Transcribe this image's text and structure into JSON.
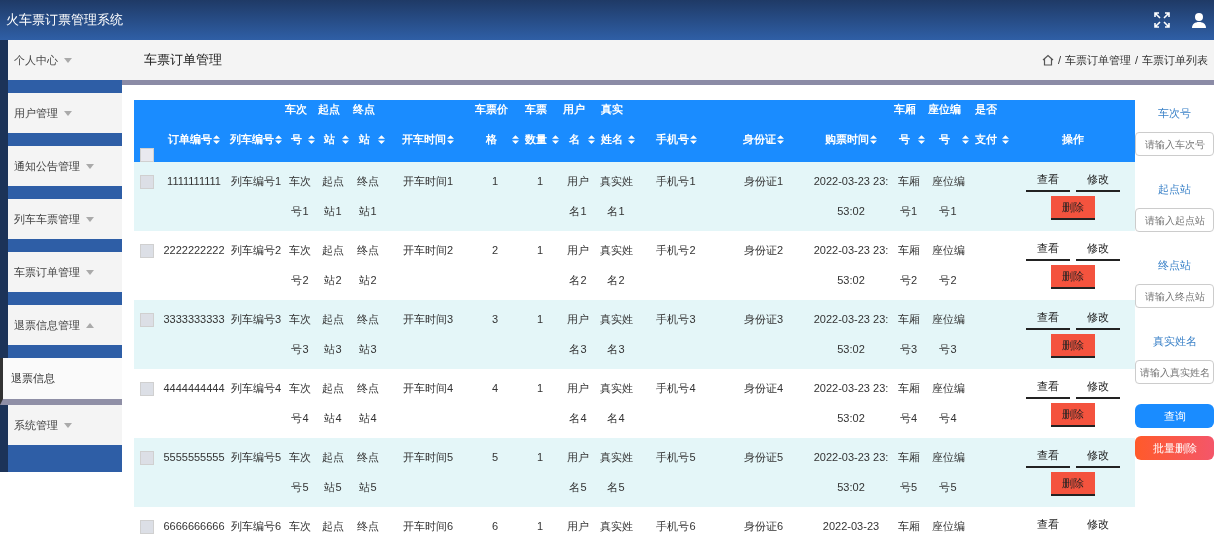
{
  "app_title": "火车票订票管理系统",
  "sidebar": {
    "items": [
      {
        "label": "个人中心",
        "expanded": false
      },
      {
        "label": "用户管理",
        "expanded": false
      },
      {
        "label": "通知公告管理",
        "expanded": false
      },
      {
        "label": "列车车票管理",
        "expanded": false
      },
      {
        "label": "车票订单管理",
        "expanded": false
      },
      {
        "label": "退票信息管理",
        "expanded": true,
        "children": [
          {
            "label": "退票信息"
          }
        ]
      },
      {
        "label": "系统管理",
        "expanded": false
      }
    ]
  },
  "page_title": "车票订单管理",
  "breadcrumb": [
    "车票订单管理",
    "车票订单列表"
  ],
  "breadcrumb_separator": "/",
  "table": {
    "select_all": {
      "checked": false
    },
    "columns": [
      {
        "label": "订单编号",
        "sortable": true
      },
      {
        "label": "列车编号",
        "sortable": true
      },
      {
        "label": "车次号",
        "sortable": true
      },
      {
        "label": "起点站",
        "sortable": true
      },
      {
        "label": "终点站",
        "sortable": true
      },
      {
        "label": "开车时间",
        "sortable": true
      },
      {
        "label": "车票价格",
        "sortable": true
      },
      {
        "label": "车票数量",
        "sortable": true
      },
      {
        "label": "用户名",
        "sortable": true
      },
      {
        "label": "真实姓名",
        "sortable": true
      },
      {
        "label": "手机号",
        "sortable": true
      },
      {
        "label": "身份证",
        "sortable": true
      },
      {
        "label": "购票时间",
        "sortable": true
      },
      {
        "label": "车厢号",
        "sortable": true
      },
      {
        "label": "座位编号",
        "sortable": true
      },
      {
        "label": "是否支付",
        "sortable": true
      },
      {
        "label": "操作",
        "sortable": false
      }
    ],
    "rows": [
      {
        "checked": false,
        "cells": [
          "1111111111",
          "列车编号1",
          "车次号1",
          "起点站1",
          "终点站1",
          "开车时间1",
          "1",
          "1",
          "用户名1",
          "真实姓名1",
          "手机号1",
          "身份证1",
          "2022-03-23 23:53:02",
          "车厢号1",
          "座位编号1"
        ],
        "actions": [
          {
            "kind": "view",
            "label": "查看"
          },
          {
            "kind": "edit",
            "label": "修改"
          },
          {
            "kind": "delete",
            "label": "删除"
          }
        ]
      },
      {
        "checked": false,
        "cells": [
          "2222222222",
          "列车编号2",
          "车次号2",
          "起点站2",
          "终点站2",
          "开车时间2",
          "2",
          "1",
          "用户名2",
          "真实姓名2",
          "手机号2",
          "身份证2",
          "2022-03-23 23:53:02",
          "车厢号2",
          "座位编号2"
        ],
        "actions": [
          {
            "kind": "view",
            "label": "查看"
          },
          {
            "kind": "edit",
            "label": "修改"
          },
          {
            "kind": "delete",
            "label": "删除"
          }
        ]
      },
      {
        "checked": false,
        "cells": [
          "3333333333",
          "列车编号3",
          "车次号3",
          "起点站3",
          "终点站3",
          "开车时间3",
          "3",
          "1",
          "用户名3",
          "真实姓名3",
          "手机号3",
          "身份证3",
          "2022-03-23 23:53:02",
          "车厢号3",
          "座位编号3"
        ],
        "actions": [
          {
            "kind": "view",
            "label": "查看"
          },
          {
            "kind": "edit",
            "label": "修改"
          },
          {
            "kind": "delete",
            "label": "删除"
          }
        ]
      },
      {
        "checked": false,
        "cells": [
          "4444444444",
          "列车编号4",
          "车次号4",
          "起点站4",
          "终点站4",
          "开车时间4",
          "4",
          "1",
          "用户名4",
          "真实姓名4",
          "手机号4",
          "身份证4",
          "2022-03-23 23:53:02",
          "车厢号4",
          "座位编号4"
        ],
        "actions": [
          {
            "kind": "view",
            "label": "查看"
          },
          {
            "kind": "edit",
            "label": "修改"
          },
          {
            "kind": "delete",
            "label": "删除"
          }
        ]
      },
      {
        "checked": false,
        "cells": [
          "5555555555",
          "列车编号5",
          "车次号5",
          "起点站5",
          "终点站5",
          "开车时间5",
          "5",
          "1",
          "用户名5",
          "真实姓名5",
          "手机号5",
          "身份证5",
          "2022-03-23 23:53:02",
          "车厢号5",
          "座位编号5"
        ],
        "actions": [
          {
            "kind": "view",
            "label": "查看"
          },
          {
            "kind": "edit",
            "label": "修改"
          },
          {
            "kind": "delete",
            "label": "删除"
          }
        ]
      },
      {
        "checked": false,
        "cells": [
          "6666666666",
          "列车编号6",
          "车次",
          "起点",
          "终点",
          "开车时间6",
          "6",
          "1",
          "用户",
          "真实姓",
          "手机号6",
          "身份证6",
          "2022-03-23",
          "车厢",
          "座位编"
        ],
        "actions": [
          {
            "kind": "view",
            "label": "查看"
          },
          {
            "kind": "edit",
            "label": "修改"
          }
        ]
      }
    ]
  },
  "search": {
    "fields": [
      {
        "label": "车次号",
        "placeholder": "请输入车次号"
      },
      {
        "label": "起点站",
        "placeholder": "请输入起点站"
      },
      {
        "label": "终点站",
        "placeholder": "请输入终点站"
      },
      {
        "label": "真实姓名",
        "placeholder": "请输入真实姓名"
      }
    ],
    "buttons": [
      {
        "kind": "search",
        "label": "查询"
      },
      {
        "kind": "batch_delete",
        "label": "批量删除"
      }
    ]
  }
}
